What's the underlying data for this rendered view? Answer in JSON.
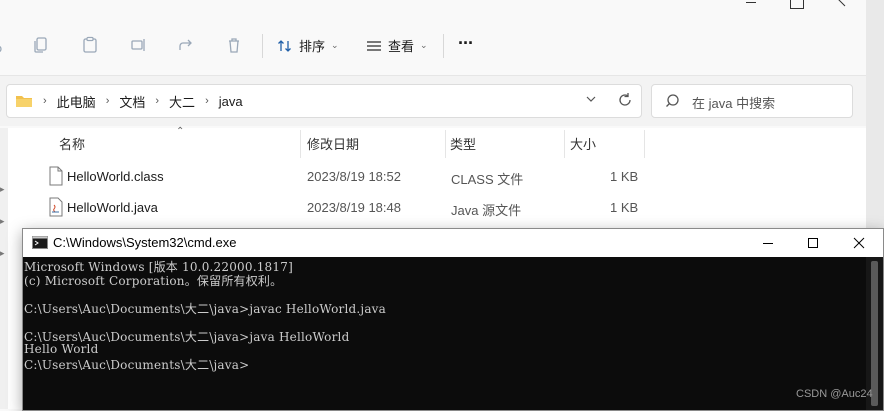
{
  "explorer": {
    "toolbar": {
      "sort_label": "排序",
      "view_label": "查看",
      "more_label": "···"
    },
    "address": {
      "crumbs": [
        "此电脑",
        "文档",
        "大二",
        "java"
      ]
    },
    "search": {
      "placeholder": "在 java 中搜索"
    },
    "columns": {
      "name": "名称",
      "modified": "修改日期",
      "type": "类型",
      "size": "大小"
    },
    "files": [
      {
        "name": "HelloWorld.class",
        "modified": "2023/8/19 18:52",
        "type": "CLASS 文件",
        "size": "1 KB",
        "icon": "file-icon"
      },
      {
        "name": "HelloWorld.java",
        "modified": "2023/8/19 18:48",
        "type": "Java 源文件",
        "size": "1 KB",
        "icon": "java-file-icon"
      }
    ]
  },
  "cmd": {
    "title": "C:\\Windows\\System32\\cmd.exe",
    "lines": [
      "Microsoft Windows [版本 10.0.22000.1817]",
      "(c) Microsoft Corporation。保留所有权利。",
      "",
      "C:\\Users\\Auc\\Documents\\大二\\java>javac HelloWorld.java",
      "",
      "C:\\Users\\Auc\\Documents\\大二\\java>java HelloWorld",
      "Hello World",
      "C:\\Users\\Auc\\Documents\\大二\\java>"
    ]
  },
  "watermark": "CSDN @Auc24"
}
